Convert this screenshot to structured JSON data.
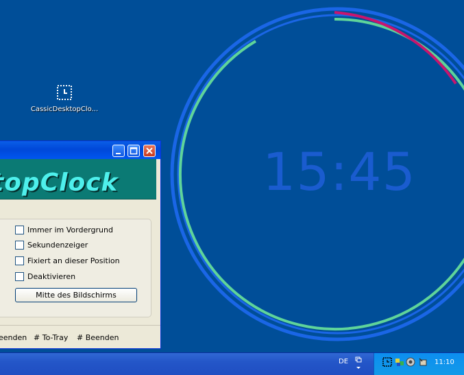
{
  "clock": {
    "time": "15:45"
  },
  "desktop_icon": {
    "label": "CassicDesktopClo..."
  },
  "window": {
    "banner": "topClock",
    "options": [
      {
        "label": "Immer im Vordergrund",
        "checked": false
      },
      {
        "label": "Sekundenzeiger",
        "checked": false
      },
      {
        "label": "Fixiert an dieser Position",
        "checked": false
      },
      {
        "label": "Deaktivieren",
        "checked": false
      }
    ],
    "center_button": "Mitte des Bildschirms",
    "status": [
      "eenden",
      "# To-Tray",
      "# Beenden"
    ]
  },
  "taskbar": {
    "language": "DE",
    "time": "11:10"
  },
  "colors": {
    "desktop": "#004e98",
    "ring_blue": "#1a66e6",
    "ring_green": "#5fd49a",
    "ring_magenta": "#c8156e"
  }
}
